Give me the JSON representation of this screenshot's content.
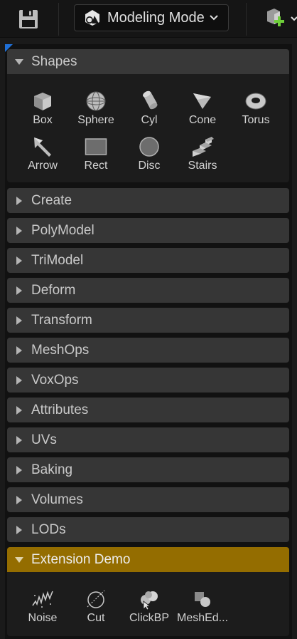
{
  "toolbar": {
    "mode_label": "Modeling Mode"
  },
  "sections": {
    "shapes": {
      "label": "Shapes",
      "tools": [
        {
          "label": "Box",
          "icon": "box-icon"
        },
        {
          "label": "Sphere",
          "icon": "sphere-icon"
        },
        {
          "label": "Cyl",
          "icon": "cylinder-icon"
        },
        {
          "label": "Cone",
          "icon": "cone-icon"
        },
        {
          "label": "Torus",
          "icon": "torus-icon"
        },
        {
          "label": "Arrow",
          "icon": "arrow-icon"
        },
        {
          "label": "Rect",
          "icon": "rect-icon"
        },
        {
          "label": "Disc",
          "icon": "disc-icon"
        },
        {
          "label": "Stairs",
          "icon": "stairs-icon"
        }
      ]
    },
    "collapsed": [
      {
        "label": "Create"
      },
      {
        "label": "PolyModel"
      },
      {
        "label": "TriModel"
      },
      {
        "label": "Deform"
      },
      {
        "label": "Transform"
      },
      {
        "label": "MeshOps"
      },
      {
        "label": "VoxOps"
      },
      {
        "label": "Attributes"
      },
      {
        "label": "UVs"
      },
      {
        "label": "Baking"
      },
      {
        "label": "Volumes"
      },
      {
        "label": "LODs"
      }
    ],
    "extension": {
      "label": "Extension Demo",
      "accent": "#946d00",
      "tools": [
        {
          "label": "Noise",
          "icon": "noise-icon"
        },
        {
          "label": "Cut",
          "icon": "cut-icon"
        },
        {
          "label": "ClickBP",
          "icon": "clickbp-icon"
        },
        {
          "label": "MeshEd...",
          "icon": "meshed-icon"
        }
      ]
    }
  }
}
